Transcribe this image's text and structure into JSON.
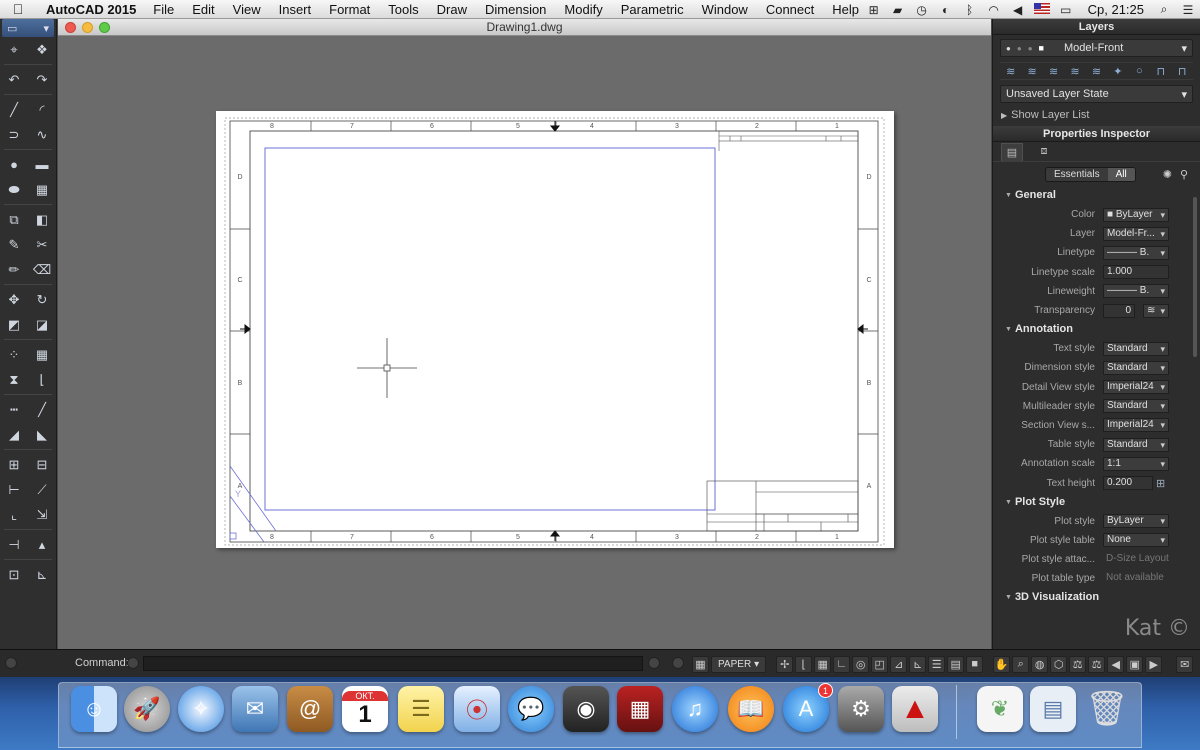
{
  "menubar": {
    "app_name": "AutoCAD 2015",
    "menus": [
      "File",
      "Edit",
      "View",
      "Insert",
      "Format",
      "Tools",
      "Draw",
      "Dimension",
      "Modify",
      "Parametric",
      "Window",
      "Connect",
      "Help"
    ],
    "clock": "Ср, 21:25"
  },
  "window": {
    "title": "Drawing1.dwg"
  },
  "sheet": {
    "col_labels": [
      "8",
      "7",
      "6",
      "5",
      "4",
      "3",
      "2",
      "1"
    ],
    "row_labels": [
      "D",
      "C",
      "B",
      "A"
    ]
  },
  "layers": {
    "header": "Layers",
    "current_layer": "Model-Front",
    "layer_state": "Unsaved Layer State",
    "show_list": "Show Layer List"
  },
  "properties": {
    "header": "Properties Inspector",
    "seg_essentials": "Essentials",
    "seg_all": "All",
    "general_title": "General",
    "general": [
      {
        "label": "Color",
        "value": "■ ByLayer"
      },
      {
        "label": "Layer",
        "value": "Model-Fr..."
      },
      {
        "label": "Linetype",
        "value": "——— B."
      },
      {
        "label": "Linetype scale",
        "value": "1.000"
      },
      {
        "label": "Lineweight",
        "value": "——— B."
      },
      {
        "label": "Transparency",
        "value": "0"
      }
    ],
    "annotation_title": "Annotation",
    "annotation": [
      {
        "label": "Text style",
        "value": "Standard"
      },
      {
        "label": "Dimension style",
        "value": "Standard"
      },
      {
        "label": "Detail View style",
        "value": "Imperial24"
      },
      {
        "label": "Multileader style",
        "value": "Standard"
      },
      {
        "label": "Section View s...",
        "value": "Imperial24"
      },
      {
        "label": "Table style",
        "value": "Standard"
      },
      {
        "label": "Annotation scale",
        "value": "1:1"
      },
      {
        "label": "Text height",
        "value": "0.200"
      }
    ],
    "plot_title": "Plot Style",
    "plot": [
      {
        "label": "Plot style",
        "value": "ByLayer"
      },
      {
        "label": "Plot style table",
        "value": "None"
      },
      {
        "label": "Plot style attac...",
        "value": "D-Size Layout"
      },
      {
        "label": "Plot table type",
        "value": "Not available"
      }
    ],
    "viz_title": "3D Visualization",
    "watermark": "Kat ©"
  },
  "command": {
    "label": "Command:",
    "paper_mode": "PAPER"
  },
  "dock": {
    "calendar_month": "ОКТ.",
    "calendar_day": "1",
    "appstore_badge": "1"
  }
}
